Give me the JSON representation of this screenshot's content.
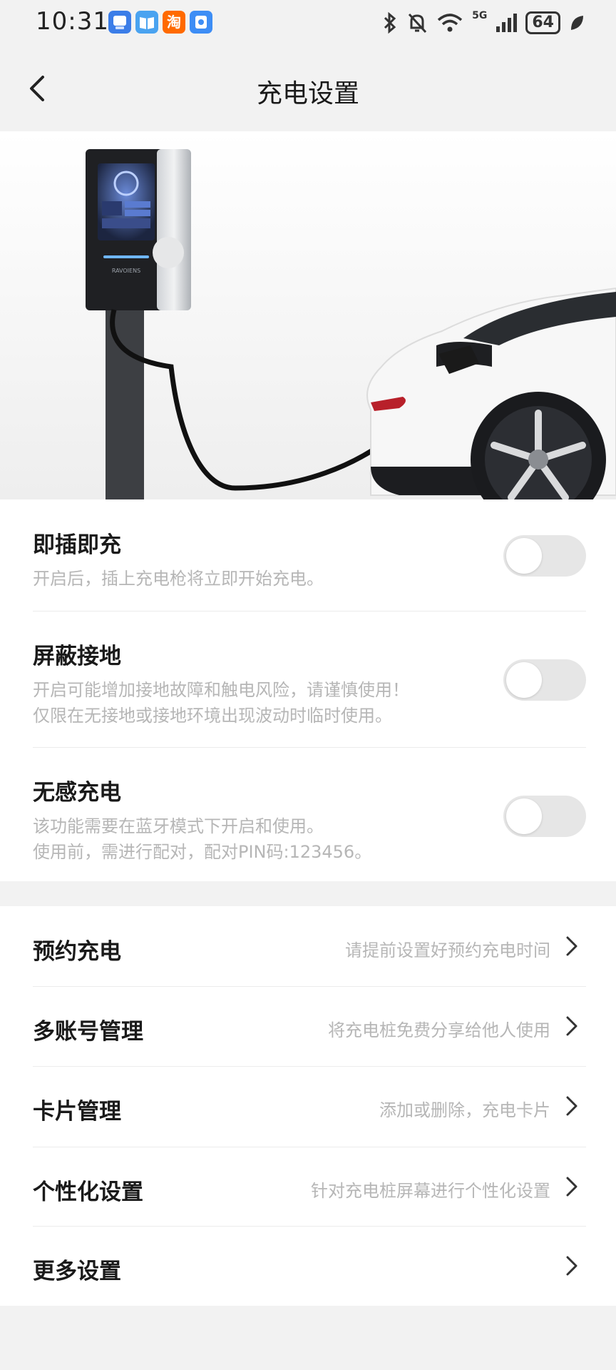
{
  "status_bar": {
    "time": "10:31",
    "app_icons": [
      "app-blue-icon",
      "reader-icon",
      "taobao-icon",
      "app-badge-icon"
    ],
    "taobao_label": "淘",
    "network": "5G",
    "battery": "64"
  },
  "header": {
    "title": "充电设置"
  },
  "hero": {
    "brand": "RAVOIENS"
  },
  "toggles": [
    {
      "title": "即插即充",
      "desc": [
        "开启后，插上充电枪将立即开始充电。"
      ],
      "on": false
    },
    {
      "title": "屏蔽接地",
      "desc": [
        "开启可能增加接地故障和触电风险，请谨慎使用！",
        "仅限在无接地或接地环境出现波动时临时使用。"
      ],
      "on": false
    },
    {
      "title": "无感充电",
      "desc": [
        "该功能需要在蓝牙模式下开启和使用。",
        "使用前，需进行配对，配对PIN码:123456。"
      ],
      "on": false
    }
  ],
  "menu": [
    {
      "title": "预约充电",
      "hint": "请提前设置好预约充电时间"
    },
    {
      "title": "多账号管理",
      "hint": "将充电桩免费分享给他人使用"
    },
    {
      "title": "卡片管理",
      "hint": "添加或删除，充电卡片"
    },
    {
      "title": "个性化设置",
      "hint": "针对充电桩屏幕进行个性化设置"
    },
    {
      "title": "更多设置",
      "hint": ""
    }
  ],
  "colors": {
    "page_bg": "#f2f2f2",
    "switch_off": "#e6e6e6",
    "hint_text": "#b6b6b6"
  }
}
